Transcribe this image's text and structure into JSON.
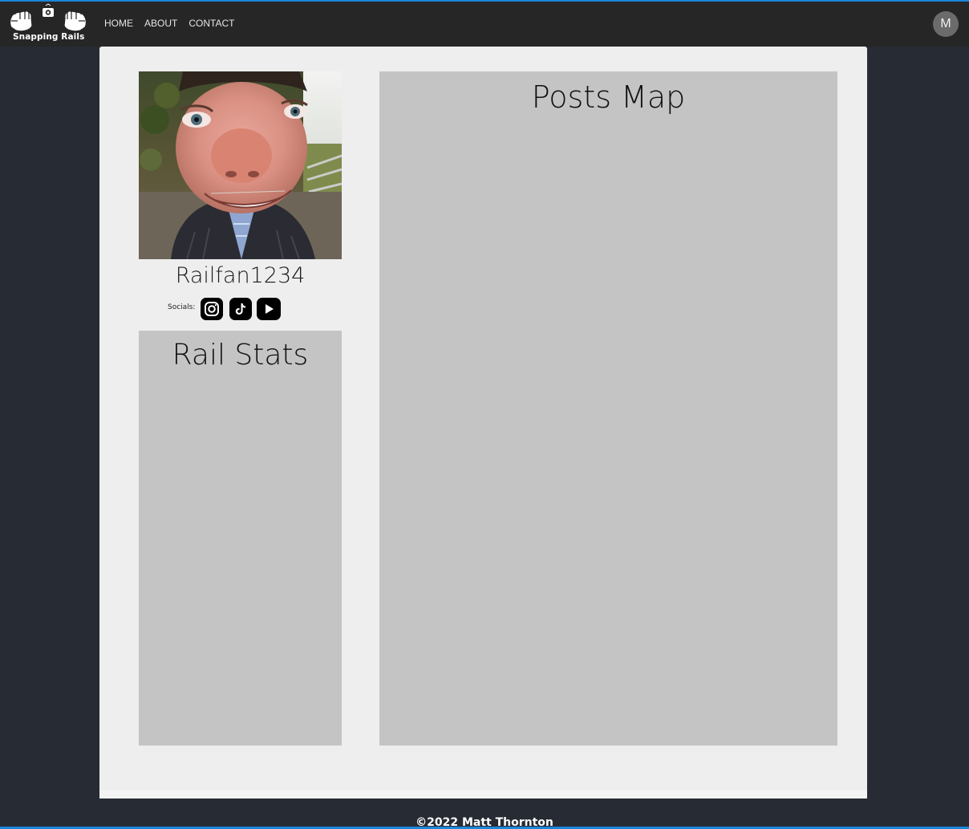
{
  "navbar": {
    "logo_text": "Snapping Rails",
    "links": [
      "HOME",
      "ABOUT",
      "CONTACT"
    ],
    "avatar_initial": "M"
  },
  "profile": {
    "username": "Railfan1234",
    "socials_label": "Socials:",
    "socials": [
      "instagram-icon",
      "tiktok-icon",
      "youtube-icon"
    ]
  },
  "panels": {
    "rail_stats_title": "Rail Stats",
    "posts_map_title": "Posts Map"
  },
  "footer": {
    "text": "©2022 Matt Thornton"
  },
  "colors": {
    "page_bg": "#272b34",
    "navbar_bg": "#262626",
    "accent_line": "#1a86d9",
    "card_bg": "#eeeeee",
    "panel_bg": "#c4c4c4"
  }
}
